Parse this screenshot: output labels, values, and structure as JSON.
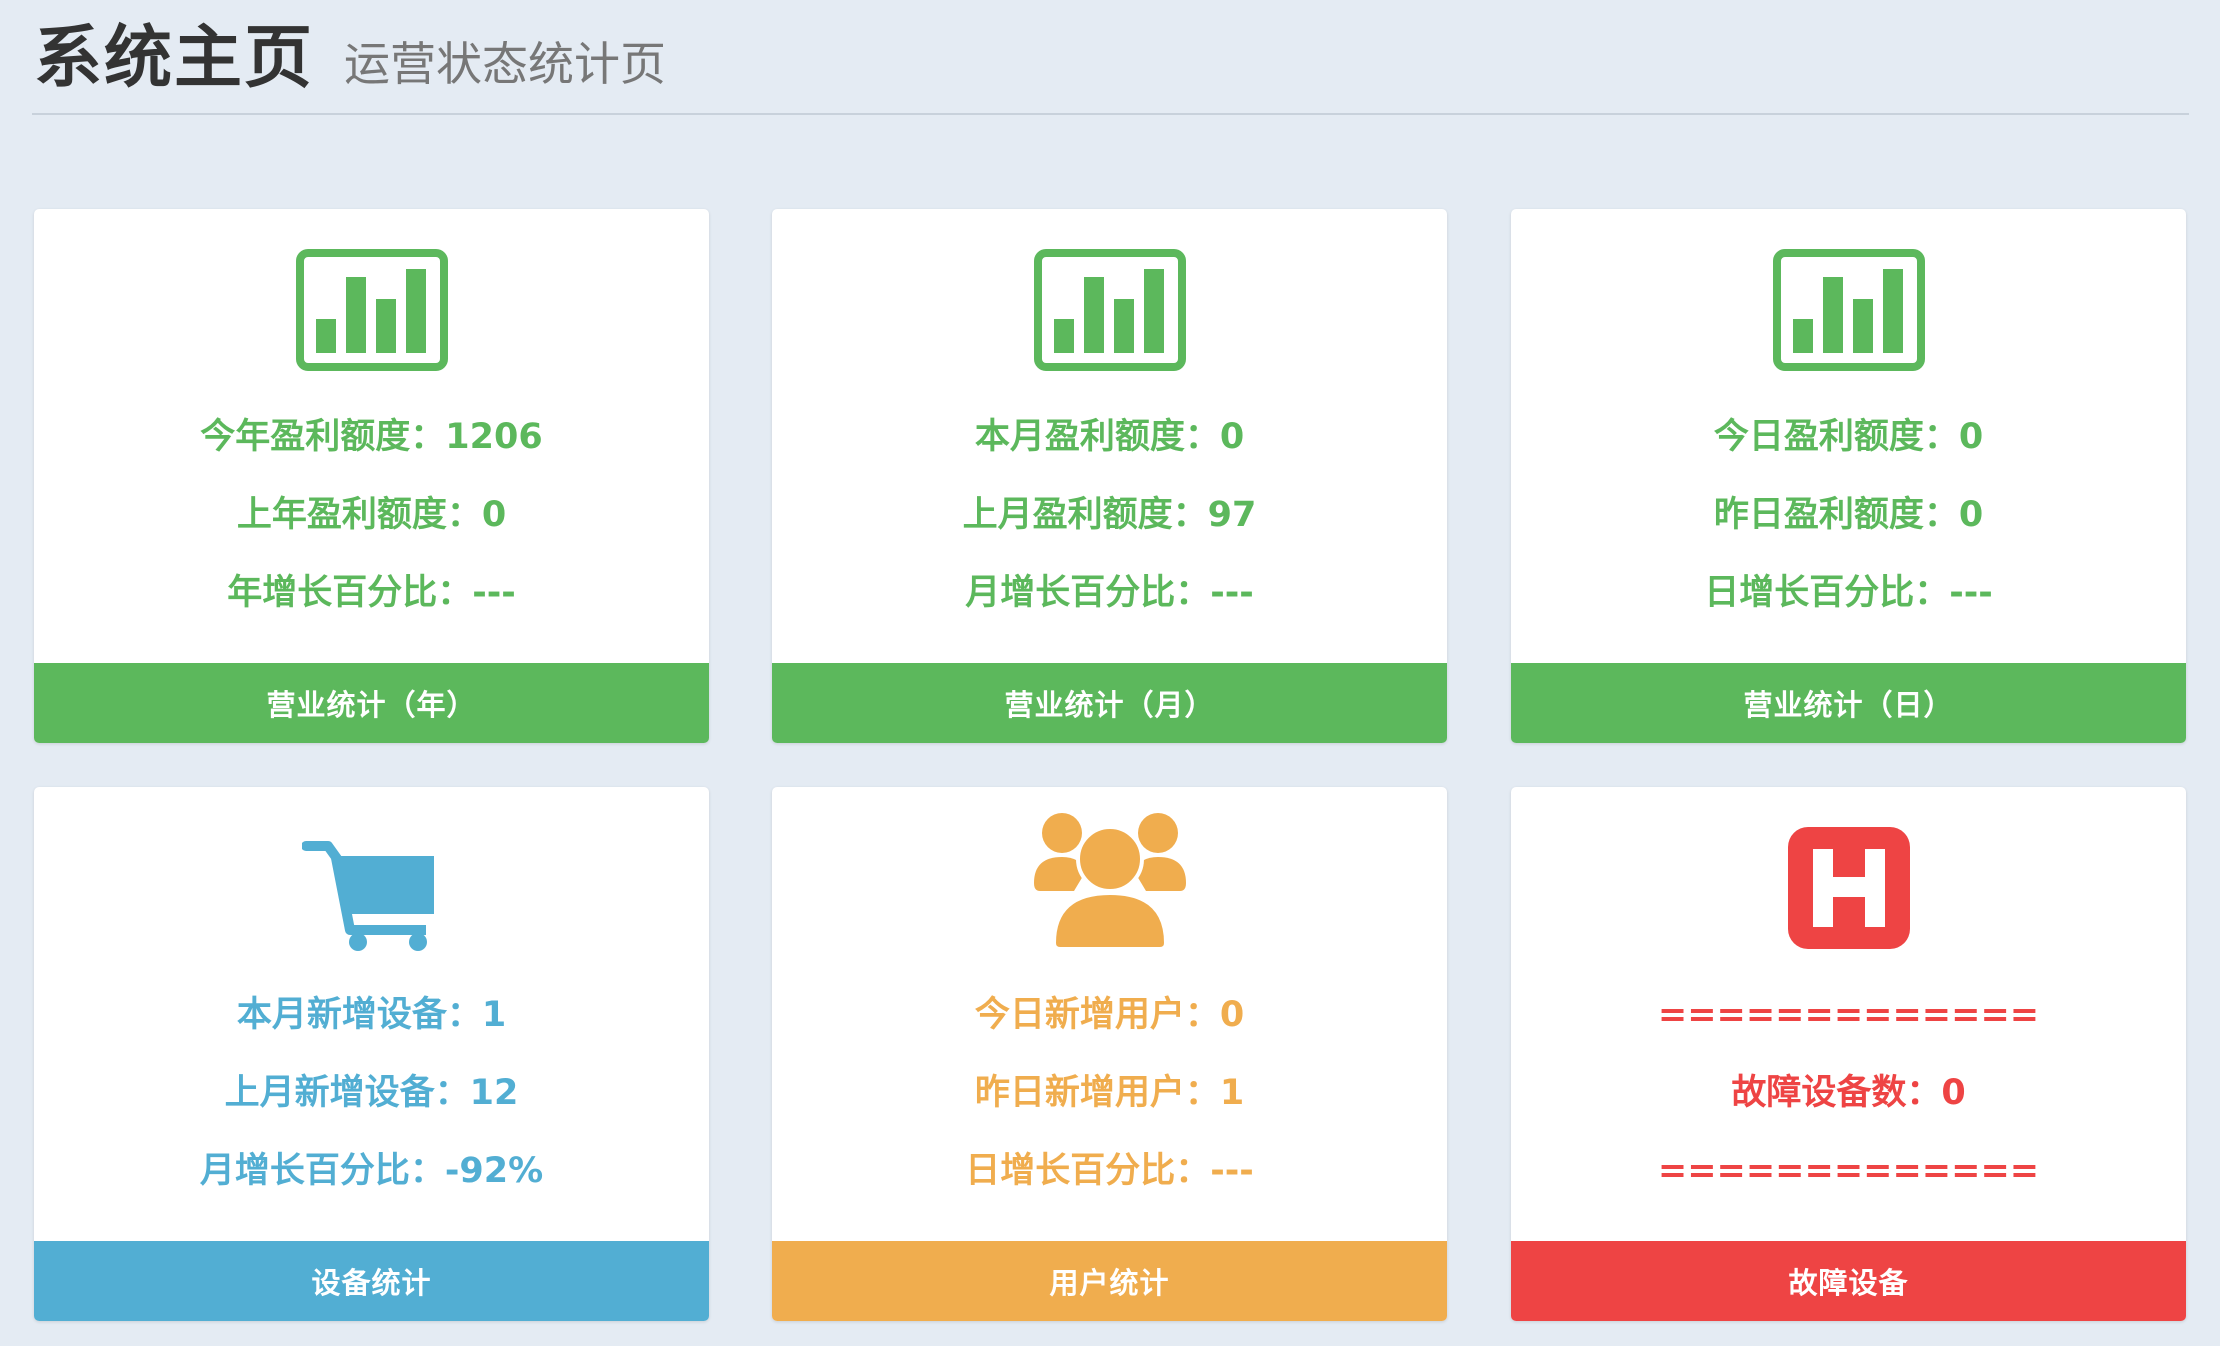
{
  "header": {
    "title": "系统主页",
    "subtitle": "运营状态统计页"
  },
  "colors": {
    "background": "#e4ebf3",
    "green": "#5cb85c",
    "blue": "#52aed3",
    "orange": "#f0ad4e",
    "red": "#ee4444"
  },
  "cards": [
    {
      "icon": "bar-chart-icon",
      "lines": [
        "今年盈利额度：1206",
        "上年盈利额度：0",
        "年增长百分比：---"
      ],
      "footer": "营业统计（年）"
    },
    {
      "icon": "bar-chart-icon",
      "lines": [
        "本月盈利额度：0",
        "上月盈利额度：97",
        "月增长百分比：---"
      ],
      "footer": "营业统计（月）"
    },
    {
      "icon": "bar-chart-icon",
      "lines": [
        "今日盈利额度：0",
        "昨日盈利额度：0",
        "日增长百分比：---"
      ],
      "footer": "营业统计（日）"
    },
    {
      "icon": "shopping-cart-icon",
      "lines": [
        "本月新增设备：1",
        "上月新增设备：12",
        "月增长百分比：-92%"
      ],
      "footer": "设备统计"
    },
    {
      "icon": "users-icon",
      "lines": [
        "今日新增用户：0",
        "昨日新增用户：1",
        "日增长百分比：---"
      ],
      "footer": "用户统计"
    },
    {
      "icon": "hospital-h-icon",
      "lines": [
        "=============",
        "故障设备数：0",
        "============="
      ],
      "footer": "故障设备"
    }
  ]
}
